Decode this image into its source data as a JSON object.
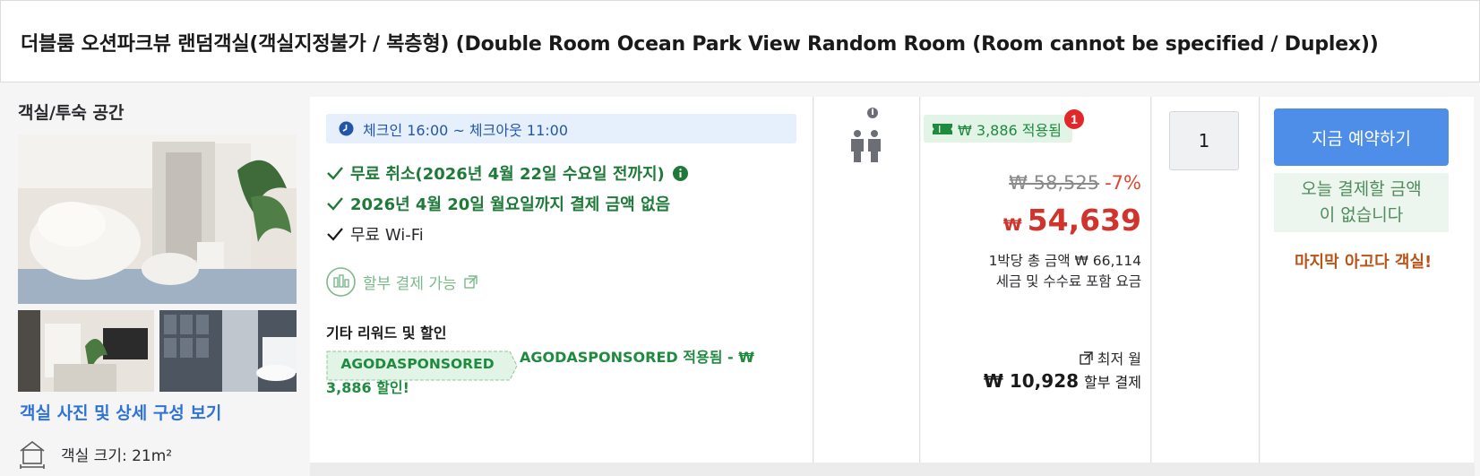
{
  "room": {
    "title": "더블룸 오션파크뷰 랜덤객실(객실지정불가 / 복층형) (Double Room Ocean Park View Random Room (Room cannot be specified / Duplex))"
  },
  "left": {
    "section_title": "객실/투숙 공간",
    "photo_link": "객실 사진 및 상세 구성 보기",
    "room_size": "객실 크기: 21m²"
  },
  "conditions": {
    "checkin": "체크인 16:00 ~ 체크아웃 11:00",
    "free_cancel": "무료 취소(2026년 4월 22일 수요일 전까지)",
    "no_payment": "2026년 4월 20일 월요일까지 결제 금액 없음",
    "wifi": "무료 Wi-Fi",
    "installment": "할부 결제 가능",
    "rewards_title": "기타 리워드 및 할인",
    "promo_code": "AGODASPONSORED",
    "promo_applied": "AGODASPONSORED 적용됨 - ₩",
    "promo_discount": "3,886 할인!"
  },
  "price": {
    "saved_label": "₩ 3,886 적용됨",
    "badge_count": "1",
    "original": "₩ 58,525",
    "discount_pct": "-7%",
    "currency": "₩",
    "amount": "54,639",
    "per_night": "1박당 총 금액 ₩ 66,114",
    "tax_note": "세금 및 수수료 포함 요금",
    "lowest_label": "최저 월",
    "monthly_amount": "₩ 10,928",
    "monthly_label": "할부 결제"
  },
  "quantity": {
    "value": "1"
  },
  "booking": {
    "button_label": "지금 예약하기",
    "pay_note_line1": "오늘 결제할 금액",
    "pay_note_line2": "이 없습니다",
    "last_room": "마지막 아고다 객실!"
  },
  "colors": {
    "accent_blue": "#4f8ee8",
    "link_blue": "#2f73d6",
    "green": "#1f7a3a",
    "price_red": "#d0342c",
    "last_room_orange": "#b8551a"
  }
}
